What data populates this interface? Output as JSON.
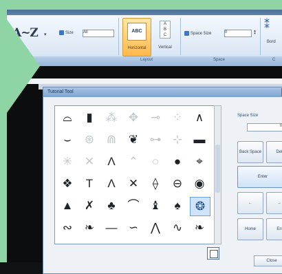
{
  "ribbon": {
    "az_label": "A~Z",
    "size_label": "Size",
    "size_value": "All",
    "horizontal_label": "Horizontal",
    "horizontal_preview": "ABC",
    "vertical_label": "Vertical",
    "space_size_label": "Space Size",
    "space_size_value": "0",
    "border_label": "Bord",
    "groups": [
      "Layout",
      "Space",
      "C"
    ]
  },
  "dialog": {
    "title": "Tutorial Tool",
    "space_size_label": "Space Size",
    "space_size_value": "0",
    "buttons": {
      "backspace": "Back Space",
      "delete": "Del",
      "enter": "Enter",
      "left": "←",
      "right": "→",
      "home": "Home",
      "end": "En",
      "close": "Close"
    }
  },
  "symbols": [
    [
      "⌓",
      "▮",
      "⁂",
      "✥",
      "⊸",
      "⁘",
      "∧"
    ],
    [
      "⌣",
      "⊛",
      "⋒",
      "❦",
      "⊶",
      "⊹",
      "▬"
    ],
    [
      "✳",
      "✕",
      "Λ",
      "⌃",
      "○",
      "●",
      "⌖"
    ],
    [
      "❖",
      "T",
      "Λ",
      "✕",
      "⟠",
      "⊖",
      "◉"
    ],
    [
      "▲",
      "✗",
      "♣",
      "⌒",
      "♝",
      "♠",
      "❂"
    ],
    [
      "∾",
      "❧",
      "—",
      "∽",
      "⋀",
      "∿",
      "❧"
    ]
  ],
  "colors": {
    "accent_green": "#8fd4a4",
    "ribbon_blue": "#dde9f6",
    "selected_orange": "#ffb84a"
  }
}
